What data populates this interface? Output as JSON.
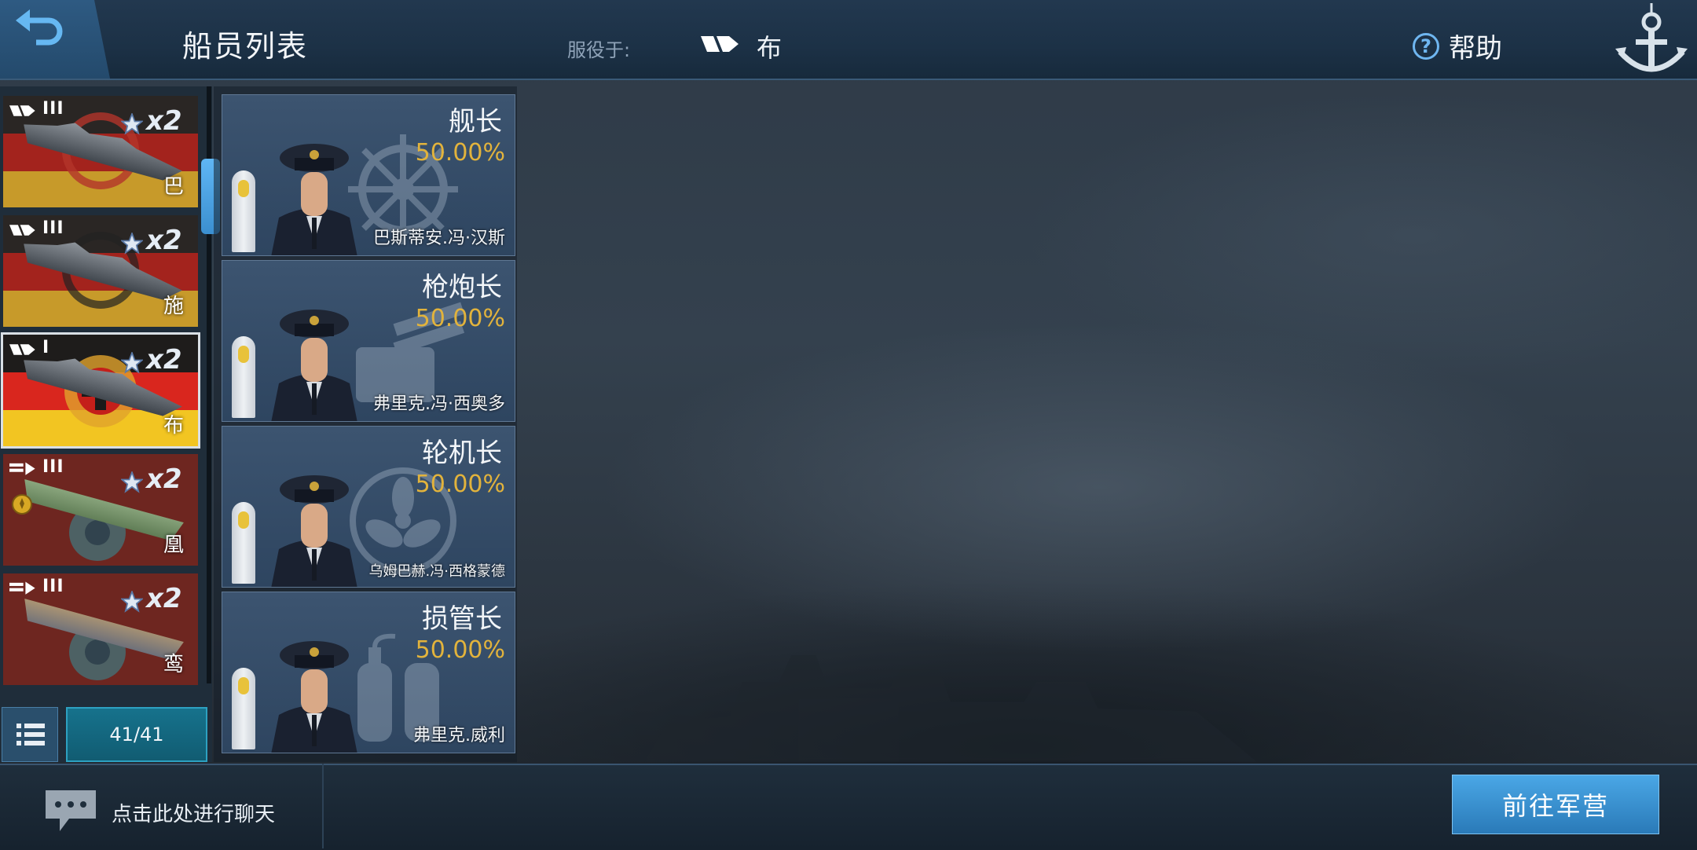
{
  "header": {
    "title": "船员列表",
    "serve_label": "服役于:",
    "serve_ship": "布",
    "help_label": "帮助"
  },
  "ships": [
    {
      "tier": "III",
      "multiplier": "x2",
      "name": "巴"
    },
    {
      "tier": "III",
      "multiplier": "x2",
      "name": "施"
    },
    {
      "tier": "I",
      "multiplier": "x2",
      "name": "布"
    },
    {
      "tier": "III",
      "multiplier": "x2",
      "name": "凰"
    },
    {
      "tier": "III",
      "multiplier": "x2",
      "name": "鸾"
    }
  ],
  "ship_count": "41/41",
  "crew": [
    {
      "role": "舰长",
      "percent": "50.00%",
      "name": "巴斯蒂安.冯·汉斯",
      "bg_icon": "ship-wheel-icon"
    },
    {
      "role": "枪炮长",
      "percent": "50.00%",
      "name": "弗里克.冯·西奥多",
      "bg_icon": "turret-icon"
    },
    {
      "role": "轮机长",
      "percent": "50.00%",
      "name": "乌姆巴赫.冯·西格蒙德",
      "bg_icon": "propeller-icon"
    },
    {
      "role": "损管长",
      "percent": "50.00%",
      "name": "弗里克.威利",
      "bg_icon": "extinguisher-icon"
    }
  ],
  "bottom": {
    "chat_prompt": "点击此处进行聊天",
    "go_button": "前往军营"
  },
  "colors": {
    "accent_blue": "#4aa7e6",
    "percent_gold": "#e2b33c",
    "count_teal": "#16728c"
  }
}
